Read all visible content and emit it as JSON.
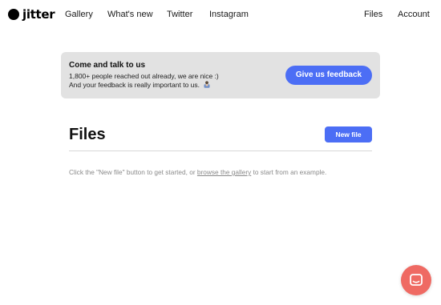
{
  "brand": {
    "name": "jitter"
  },
  "nav": {
    "left": [
      "Gallery",
      "What's new",
      "Twitter",
      "Instagram"
    ],
    "right": [
      "Files",
      "Account"
    ]
  },
  "banner": {
    "title": "Come and talk to us",
    "line1": "1,800+ people reached out already, we are nice :)",
    "line2": "And your feedback is really important to us.",
    "emoji_icon": "person-bowing-icon",
    "button": "Give us feedback"
  },
  "files": {
    "title": "Files",
    "new_button": "New file",
    "hint_before": "Click the \"New file\" button to get started, or ",
    "hint_link": "browse the gallery",
    "hint_after": " to start from an example."
  },
  "chat": {
    "icon": "chat-icon"
  },
  "colors": {
    "accent": "#4c6ef5",
    "banner_bg": "#e2e2e2",
    "chat": "#ef6a63"
  }
}
